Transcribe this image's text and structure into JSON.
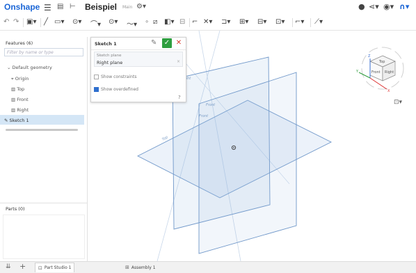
{
  "app": {
    "logo": "Onshape",
    "doc_title": "Beispiel",
    "branch": "Main"
  },
  "header_icons": {
    "menu": "☰",
    "docs": "▤",
    "version": "⊢",
    "gear": "⚙▾",
    "comment": "●",
    "share": "⋖▾",
    "help": "◉▾",
    "user": "∩▾"
  },
  "toolbar": {
    "undo": "↶",
    "redo": "↷",
    "features": "▣▾",
    "line": "╱",
    "rect": "▭▾",
    "circle": "⊙▾",
    "arc": "⌒▾",
    "spline": "⊙▾",
    "curve": "～▾",
    "point": "∘",
    "sketch_mirror": "⧄",
    "construction": "◧▾",
    "plane": "⊟",
    "fillet": "⌐",
    "trim": "✕▾",
    "offset": "⊐▾",
    "pattern": "⊞▾",
    "dimension": "⊟▾",
    "mate": "⊡▾",
    "tangent": "⌐▾",
    "constraint": "⟋▾"
  },
  "feature_list": {
    "header": "Features (6)",
    "filter_placeholder": "Filter by name or type",
    "items": [
      {
        "label": "⌄ Default geometry"
      },
      {
        "label": "⌖ Origin"
      },
      {
        "label": "▥ Top"
      },
      {
        "label": "▥ Front"
      },
      {
        "label": "▥ Right"
      },
      {
        "label": "✎ Sketch 1"
      }
    ]
  },
  "parts": {
    "header": "Parts (0)"
  },
  "dialog": {
    "title": "Sketch 1",
    "ok": "✓",
    "cancel": "✕",
    "pencil": "✎",
    "field_label": "Sketch plane",
    "field_value": "Right plane",
    "field_clear": "×",
    "show_constraints": "Show constraints",
    "show_overdefined": "Show overdefined",
    "help": "?"
  },
  "viewport": {
    "labels": {
      "right": "Right",
      "front": "Front",
      "top": "Top"
    }
  },
  "view_cube": {
    "face_top": "Top",
    "face_front": "Front",
    "face_right": "Right",
    "axis_x": "X",
    "axis_y": "Y",
    "axis_z": "Z",
    "menu": "⊡▾"
  },
  "bottom_bar": {
    "icons": {
      "panel": "⇊",
      "add": "+"
    },
    "tabs": [
      {
        "icon": "⊡",
        "label": "Part Studio 1"
      },
      {
        "icon": "⊞",
        "label": "Assembly 1"
      }
    ]
  },
  "colors": {
    "brand": "#1b66d6",
    "accept": "#2e9e3f",
    "cancel": "#d93b2f",
    "plane": "#4a7fc1",
    "selection": "#d4e6f6"
  }
}
